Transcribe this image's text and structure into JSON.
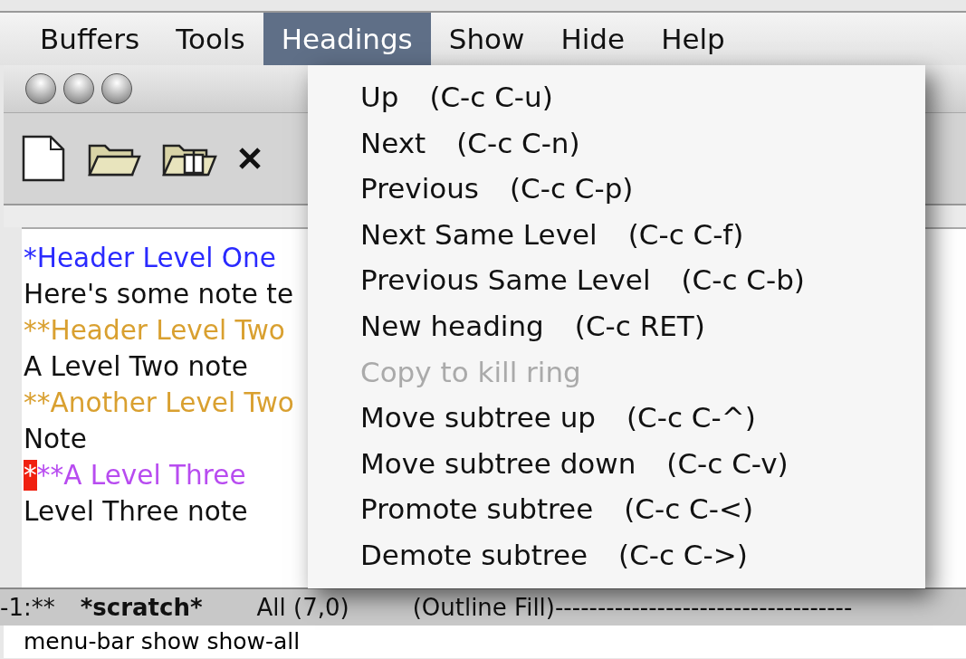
{
  "menu_bar": [
    {
      "label": "Buffers",
      "selected": false
    },
    {
      "label": "Tools",
      "selected": false
    },
    {
      "label": "Headings",
      "selected": true
    },
    {
      "label": "Show",
      "selected": false
    },
    {
      "label": "Hide",
      "selected": false
    },
    {
      "label": "Help",
      "selected": false
    }
  ],
  "buffer_lines": [
    {
      "text": "*Header Level One",
      "color": "#2a2aff",
      "cursor": false
    },
    {
      "text": "Here's some note te",
      "color": "#111111",
      "cursor": false
    },
    {
      "text": "**Header Level Two",
      "color": "#d9a030",
      "cursor": false
    },
    {
      "text": "A Level Two note",
      "color": "#111111",
      "cursor": false
    },
    {
      "text": "**Another Level Two",
      "color": "#d9a030",
      "cursor": false
    },
    {
      "text": "Note",
      "color": "#111111",
      "cursor": false
    },
    {
      "text": "***A Level Three",
      "color": "#b84cf0",
      "cursor": true
    },
    {
      "text": "Level Three note",
      "color": "#111111",
      "cursor": false
    }
  ],
  "headings_menu": [
    {
      "label": "Up",
      "shortcut": "(C-c C-u)",
      "disabled": false
    },
    {
      "label": "Next",
      "shortcut": "(C-c C-n)",
      "disabled": false
    },
    {
      "label": "Previous",
      "shortcut": "(C-c C-p)",
      "disabled": false
    },
    {
      "label": "Next Same Level",
      "shortcut": "(C-c C-f)",
      "disabled": false
    },
    {
      "label": "Previous Same Level",
      "shortcut": "(C-c C-b)",
      "disabled": false
    },
    {
      "label": "New heading",
      "shortcut": "(C-c RET)",
      "disabled": false
    },
    {
      "label": "Copy to kill ring",
      "disabled": true
    },
    {
      "label": "Move subtree up",
      "shortcut": "(C-c C-^)",
      "disabled": false
    },
    {
      "label": "Move subtree down",
      "shortcut": "(C-c C-v)",
      "disabled": false
    },
    {
      "label": "Promote subtree",
      "shortcut": "(C-c C-<)",
      "disabled": false
    },
    {
      "label": "Demote subtree",
      "shortcut": "(C-c C->)",
      "disabled": false
    }
  ],
  "mode_line": {
    "status": "-1:**",
    "buffer": "*scratch*",
    "position": "All (7,0)",
    "modes": "(Outline Fill)-----------------------------------"
  },
  "minibuffer": "menu-bar show show-all"
}
